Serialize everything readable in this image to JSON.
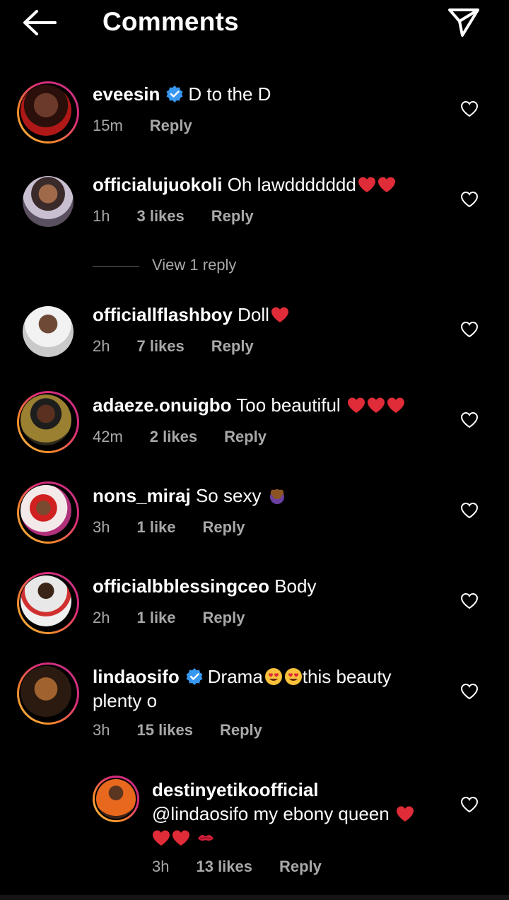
{
  "header": {
    "title": "Comments"
  },
  "comments": [
    {
      "username": "eveesin",
      "verified": true,
      "text": "D to the D",
      "time": "15m",
      "likes": "",
      "reply": "Reply"
    },
    {
      "username": "officialujuokoli",
      "verified": false,
      "text": "Oh lawddddddd",
      "time": "1h",
      "likes": "3 likes",
      "reply": "Reply"
    },
    {
      "username": "officiallflashboy",
      "verified": false,
      "text": "Doll",
      "time": "2h",
      "likes": "7 likes",
      "reply": "Reply"
    },
    {
      "username": "adaeze.onuigbo",
      "verified": false,
      "text": "Too beautiful",
      "time": "42m",
      "likes": "2 likes",
      "reply": "Reply"
    },
    {
      "username": "nons_miraj",
      "verified": false,
      "text": "So sexy",
      "time": "3h",
      "likes": "1 like",
      "reply": "Reply"
    },
    {
      "username": "officialbblessingceo",
      "verified": false,
      "text": "Body",
      "time": "2h",
      "likes": "1 like",
      "reply": "Reply"
    },
    {
      "username": "lindaosifo",
      "verified": true,
      "text_a": "Drama",
      "text_b": "this beauty",
      "text_c": "plenty o",
      "time": "3h",
      "likes": "15 likes",
      "reply": "Reply"
    }
  ],
  "view_replies": "View 1 reply",
  "reply_comment": {
    "username": "destinyetikoofficial",
    "text_a": "@lindaosifo my ebony queen",
    "time": "3h",
    "likes": "13 likes",
    "reply": "Reply"
  },
  "colors": {
    "heart": "#e02b38",
    "verified": "#3897f0",
    "meta": "#a8a8a8"
  }
}
